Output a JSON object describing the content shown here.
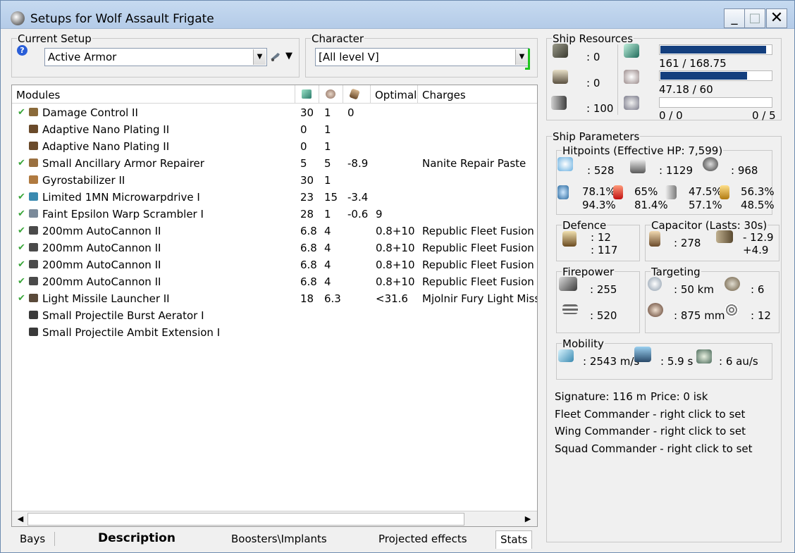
{
  "window": {
    "title": "Setups for Wolf Assault Frigate",
    "min_label": "_",
    "max_label": "□",
    "close_label": "✕"
  },
  "current_setup": {
    "legend": "Current Setup",
    "value": "Active Armor",
    "help_label": "?"
  },
  "character": {
    "legend": "Character",
    "value": "[All level V]"
  },
  "modules": {
    "headers": [
      "Modules",
      "",
      "",
      "",
      "Optimal",
      "Charges"
    ],
    "rows": [
      {
        "active": true,
        "name": "Damage Control II",
        "cpu": "30",
        "pg": "1",
        "cap": "0",
        "optimal": "",
        "charges": "",
        "icon_color": "#8a6a3a"
      },
      {
        "active": false,
        "name": "Adaptive Nano Plating II",
        "cpu": "0",
        "pg": "1",
        "cap": "",
        "optimal": "",
        "charges": "",
        "icon_color": "#6a4a2a"
      },
      {
        "active": false,
        "name": "Adaptive Nano Plating II",
        "cpu": "0",
        "pg": "1",
        "cap": "",
        "optimal": "",
        "charges": "",
        "icon_color": "#6a4a2a"
      },
      {
        "active": true,
        "name": "Small Ancillary Armor Repairer",
        "cpu": "5",
        "pg": "5",
        "cap": "-8.9",
        "optimal": "",
        "charges": "Nanite Repair Paste",
        "icon_color": "#9a7040"
      },
      {
        "active": false,
        "name": "Gyrostabilizer II",
        "cpu": "30",
        "pg": "1",
        "cap": "",
        "optimal": "",
        "charges": "",
        "icon_color": "#b07a40"
      },
      {
        "active": true,
        "name": "Limited 1MN Microwarpdrive I",
        "cpu": "23",
        "pg": "15",
        "cap": "-3.4",
        "optimal": "",
        "charges": "",
        "icon_color": "#3a8ab0"
      },
      {
        "active": true,
        "name": "Faint Epsilon Warp Scrambler I",
        "cpu": "28",
        "pg": "1",
        "cap": "-0.6",
        "optimal": "9",
        "charges": "",
        "icon_color": "#7a8a9a"
      },
      {
        "active": true,
        "name": "200mm AutoCannon II",
        "cpu": "6.8",
        "pg": "4",
        "cap": "",
        "optimal": "0.8+10",
        "charges": "Republic Fleet Fusion S",
        "icon_color": "#4a4a4a"
      },
      {
        "active": true,
        "name": "200mm AutoCannon II",
        "cpu": "6.8",
        "pg": "4",
        "cap": "",
        "optimal": "0.8+10",
        "charges": "Republic Fleet Fusion S",
        "icon_color": "#4a4a4a"
      },
      {
        "active": true,
        "name": "200mm AutoCannon II",
        "cpu": "6.8",
        "pg": "4",
        "cap": "",
        "optimal": "0.8+10",
        "charges": "Republic Fleet Fusion S",
        "icon_color": "#4a4a4a"
      },
      {
        "active": true,
        "name": "200mm AutoCannon II",
        "cpu": "6.8",
        "pg": "4",
        "cap": "",
        "optimal": "0.8+10",
        "charges": "Republic Fleet Fusion S",
        "icon_color": "#4a4a4a"
      },
      {
        "active": true,
        "name": "Light Missile Launcher II",
        "cpu": "18",
        "pg": "6.3",
        "cap": "",
        "optimal": "<31.6",
        "charges": "Mjolnir Fury Light Missile",
        "icon_color": "#5a4a3a"
      },
      {
        "active": false,
        "name": "Small Projectile Burst Aerator I",
        "cpu": "",
        "pg": "",
        "cap": "",
        "optimal": "",
        "charges": "",
        "icon_color": "#3a3a3a"
      },
      {
        "active": false,
        "name": "Small Projectile Ambit Extension I",
        "cpu": "",
        "pg": "",
        "cap": "",
        "optimal": "",
        "charges": "",
        "icon_color": "#3a3a3a"
      }
    ]
  },
  "tabs": [
    "Bays",
    "Description",
    "Boosters\\Implants",
    "Projected effects",
    "Stats"
  ],
  "ship_resources": {
    "legend": "Ship Resources",
    "turret_slots": ": 0",
    "launcher_slots": ": 0",
    "calibration": ": 100",
    "cpu_text": "161 / 168.75",
    "cpu_fraction": 0.954,
    "pg_text": "47.18 / 60",
    "pg_fraction": 0.786,
    "drone_bandwidth_text": "0 / 0",
    "drone_bandwidth_fraction": 0,
    "drone_count_text": "0 / 5",
    "drone_bay_fraction": 0
  },
  "ship_parameters": {
    "legend": "Ship Parameters",
    "hitpoints": {
      "legend": "Hitpoints (Effective HP: 7,599)",
      "shield": ": 528",
      "armor": ": 1129",
      "hull": ": 968",
      "em": [
        "78.1%",
        "94.3%"
      ],
      "thermal": [
        "65%",
        "81.4%"
      ],
      "kinetic": [
        "47.5%",
        "57.1%"
      ],
      "explosive": [
        "56.3%",
        "48.5%"
      ]
    },
    "defence": {
      "legend": "Defence",
      "v1": ": 12",
      "v2": ": 117"
    },
    "capacitor": {
      "legend": "Capacitor (Lasts: 30s)",
      "capacity": ": 278",
      "delta1": "- 12.9",
      "delta2": "+4.9"
    },
    "firepower": {
      "legend": "Firepower",
      "weapon_dps": ": 255",
      "volley": ": 520"
    },
    "targeting": {
      "legend": "Targeting",
      "range": ": 50 km",
      "targets": ": 6",
      "resolution": ": 875 mm",
      "sensor": ": 12"
    },
    "mobility": {
      "legend": "Mobility",
      "speed": ": 2543 m/s",
      "align": ": 5.9 s",
      "warp": ": 6 au/s"
    }
  },
  "footer": {
    "signature": "Signature: 116 m",
    "price": "Price: 0 isk",
    "fleet": "Fleet Commander - right click to set",
    "wing": "Wing Commander - right click to set",
    "squad": "Squad Commander - right click to set"
  }
}
